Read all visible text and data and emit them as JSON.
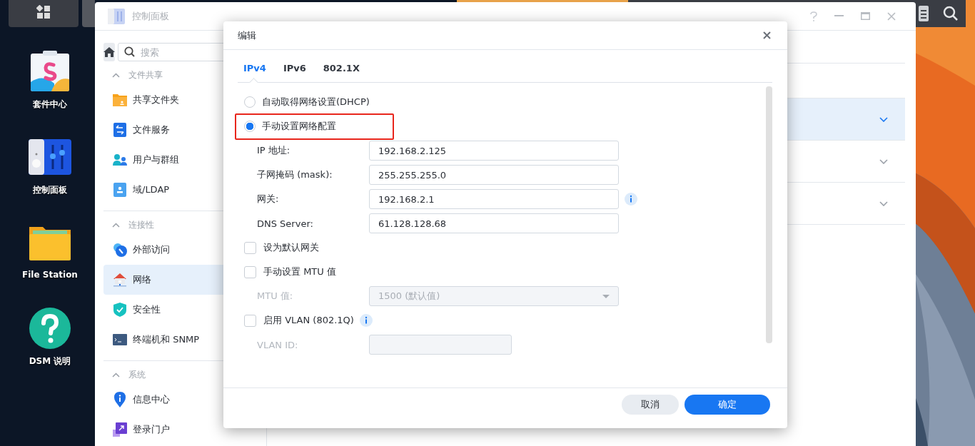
{
  "desktop_icons": [
    {
      "label": "套件中心",
      "kind": "package"
    },
    {
      "label": "控制面板",
      "kind": "panel"
    },
    {
      "label": "File Station",
      "kind": "folder"
    },
    {
      "label": "DSM 说明",
      "kind": "help"
    }
  ],
  "control_panel": {
    "title": "控制面板",
    "search": {
      "placeholder": "搜索"
    },
    "sections": [
      {
        "title": "文件共享",
        "expanded": true,
        "items": [
          {
            "label": "共享文件夹",
            "selected": false
          },
          {
            "label": "文件服务",
            "selected": false
          },
          {
            "label": "用户与群组",
            "selected": false
          },
          {
            "label": "域/LDAP",
            "selected": false
          }
        ]
      },
      {
        "title": "连接性",
        "expanded": true,
        "items": [
          {
            "label": "外部访问",
            "selected": false
          },
          {
            "label": "网络",
            "selected": true
          },
          {
            "label": "安全性",
            "selected": false
          },
          {
            "label": "终端机和 SNMP",
            "selected": false
          }
        ]
      },
      {
        "title": "系统",
        "expanded": true,
        "items": [
          {
            "label": "信息中心",
            "selected": false
          },
          {
            "label": "登录门户",
            "selected": false
          }
        ]
      }
    ],
    "rows": [
      {
        "selected": true
      },
      {
        "selected": false
      },
      {
        "selected": false
      }
    ]
  },
  "dialog": {
    "title": "编辑",
    "tabs": [
      {
        "label": "IPv4",
        "selected": true
      },
      {
        "label": "IPv6",
        "selected": false
      },
      {
        "label": "802.1X",
        "selected": false
      }
    ],
    "form": [
      {
        "kind": "radio",
        "label": "自动取得网络设置(DHCP)",
        "selected": false,
        "highlighted": false
      },
      {
        "kind": "radio",
        "label": "手动设置网络配置",
        "selected": true,
        "highlighted": true
      },
      {
        "kind": "field",
        "label": "IP 地址:",
        "value": "192.168.2.125",
        "disabled": false,
        "info": false
      },
      {
        "kind": "field",
        "label": "子网掩码 (mask):",
        "value": "255.255.255.0",
        "disabled": false,
        "info": false
      },
      {
        "kind": "field",
        "label": "网关:",
        "value": "192.168.2.1",
        "disabled": false,
        "info": true
      },
      {
        "kind": "field",
        "label": "DNS Server:",
        "value": "61.128.128.68",
        "disabled": false,
        "info": false
      },
      {
        "kind": "checkbox",
        "label": "设为默认网关",
        "checked": false,
        "info": false
      },
      {
        "kind": "checkbox",
        "label": "手动设置 MTU 值",
        "checked": false,
        "info": false
      },
      {
        "kind": "select",
        "label": "MTU 值:",
        "value": "1500 (默认值)",
        "disabled": true
      },
      {
        "kind": "checkbox",
        "label": "启用 VLAN (802.1Q)",
        "checked": false,
        "info": true
      },
      {
        "kind": "field",
        "label": "VLAN ID:",
        "disabled": true,
        "info": false,
        "short": true
      }
    ],
    "buttons": [
      {
        "label": "取消",
        "kind": "secondary"
      },
      {
        "label": "确定",
        "kind": "primary"
      }
    ]
  }
}
